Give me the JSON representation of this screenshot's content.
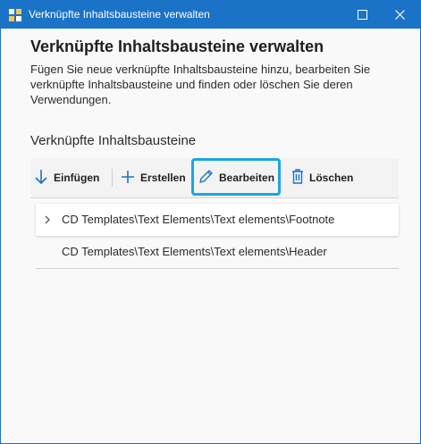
{
  "window": {
    "title": "Verknüpfte Inhaltsbausteine verwalten",
    "accent_color": "#1a73c7"
  },
  "dialog": {
    "heading": "Verknüpfte Inhaltsbausteine verwalten",
    "description": "Fügen Sie neue verknüpfte Inhaltsbausteine hinzu, bearbeiten Sie verknüpfte Inhaltsbausteine und finden oder löschen Sie deren Verwendungen.",
    "section_title": "Verknüpfte Inhaltsbausteine"
  },
  "toolbar": {
    "insert_label": "Einfügen",
    "create_label": "Erstellen",
    "edit_label": "Bearbeiten",
    "delete_label": "Löschen",
    "highlight_color": "#1aa7df"
  },
  "items": [
    {
      "label": "CD Templates\\Text Elements\\Text elements\\Footnote",
      "expandable": true,
      "selected": true
    },
    {
      "label": "CD Templates\\Text Elements\\Text elements\\Header",
      "expandable": false,
      "selected": false
    }
  ],
  "icons": [
    "app-icon",
    "maximize-icon",
    "close-icon",
    "arrow-down-icon",
    "plus-icon",
    "pencil-icon",
    "trash-icon",
    "chevron-right-icon"
  ]
}
